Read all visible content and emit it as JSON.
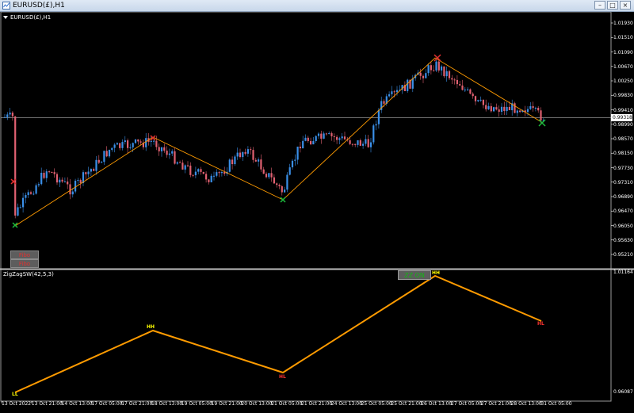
{
  "window": {
    "title": "EURUSD(£),H1",
    "minimize": "–",
    "maximize": "□",
    "close": "×"
  },
  "chart": {
    "symbol_label": "EURUSD(£),H1",
    "indicator_label": "ZigZagSW(42,5,3)",
    "fibo_buttons": [
      "Fibo",
      "Fibo"
    ],
    "zz_button": "ZZ ON",
    "current_price": "0.99318",
    "colors": {
      "bull_candle": "#3a8fe8",
      "bear_candle": "#e06070",
      "zigzag": "#ff9b00",
      "up_arrow": "#1dbb3c",
      "down_arrow": "#e23030",
      "grid_line": "#9a9a9a",
      "hh_label": "#ffff00",
      "hl_label": "#ff3333"
    }
  },
  "price_axis": [
    "1.01930",
    "1.01510",
    "1.01090",
    "1.00670",
    "1.00250",
    "0.99830",
    "0.99410",
    "0.98990",
    "0.98570",
    "0.98150",
    "0.97730",
    "0.97310",
    "0.96890",
    "0.96470",
    "0.96050",
    "0.95630",
    "0.95210"
  ],
  "indicator_axis": [
    "1.01164",
    "0.96087"
  ],
  "time_axis": [
    "13 Oct 2022",
    "13 Oct 21:00",
    "14 Oct 13:00",
    "17 Oct 05:00",
    "17 Oct 21:00",
    "18 Oct 13:00",
    "19 Oct 05:00",
    "19 Oct 21:00",
    "20 Oct 13:00",
    "21 Oct 05:00",
    "21 Oct 21:00",
    "24 Oct 13:00",
    "25 Oct 05:00",
    "25 Oct 21:00",
    "26 Oct 13:00",
    "27 Oct 05:00",
    "27 Oct 21:00",
    "28 Oct 13:00",
    "31 Oct 05:00"
  ],
  "zigzag_labels": [
    {
      "text": "LL",
      "color": "#ffff00"
    },
    {
      "text": "HH",
      "color": "#ffff00"
    },
    {
      "text": "HL",
      "color": "#ff3333"
    },
    {
      "text": "HH",
      "color": "#ffff00"
    },
    {
      "text": "HL",
      "color": "#ff3333"
    }
  ]
}
